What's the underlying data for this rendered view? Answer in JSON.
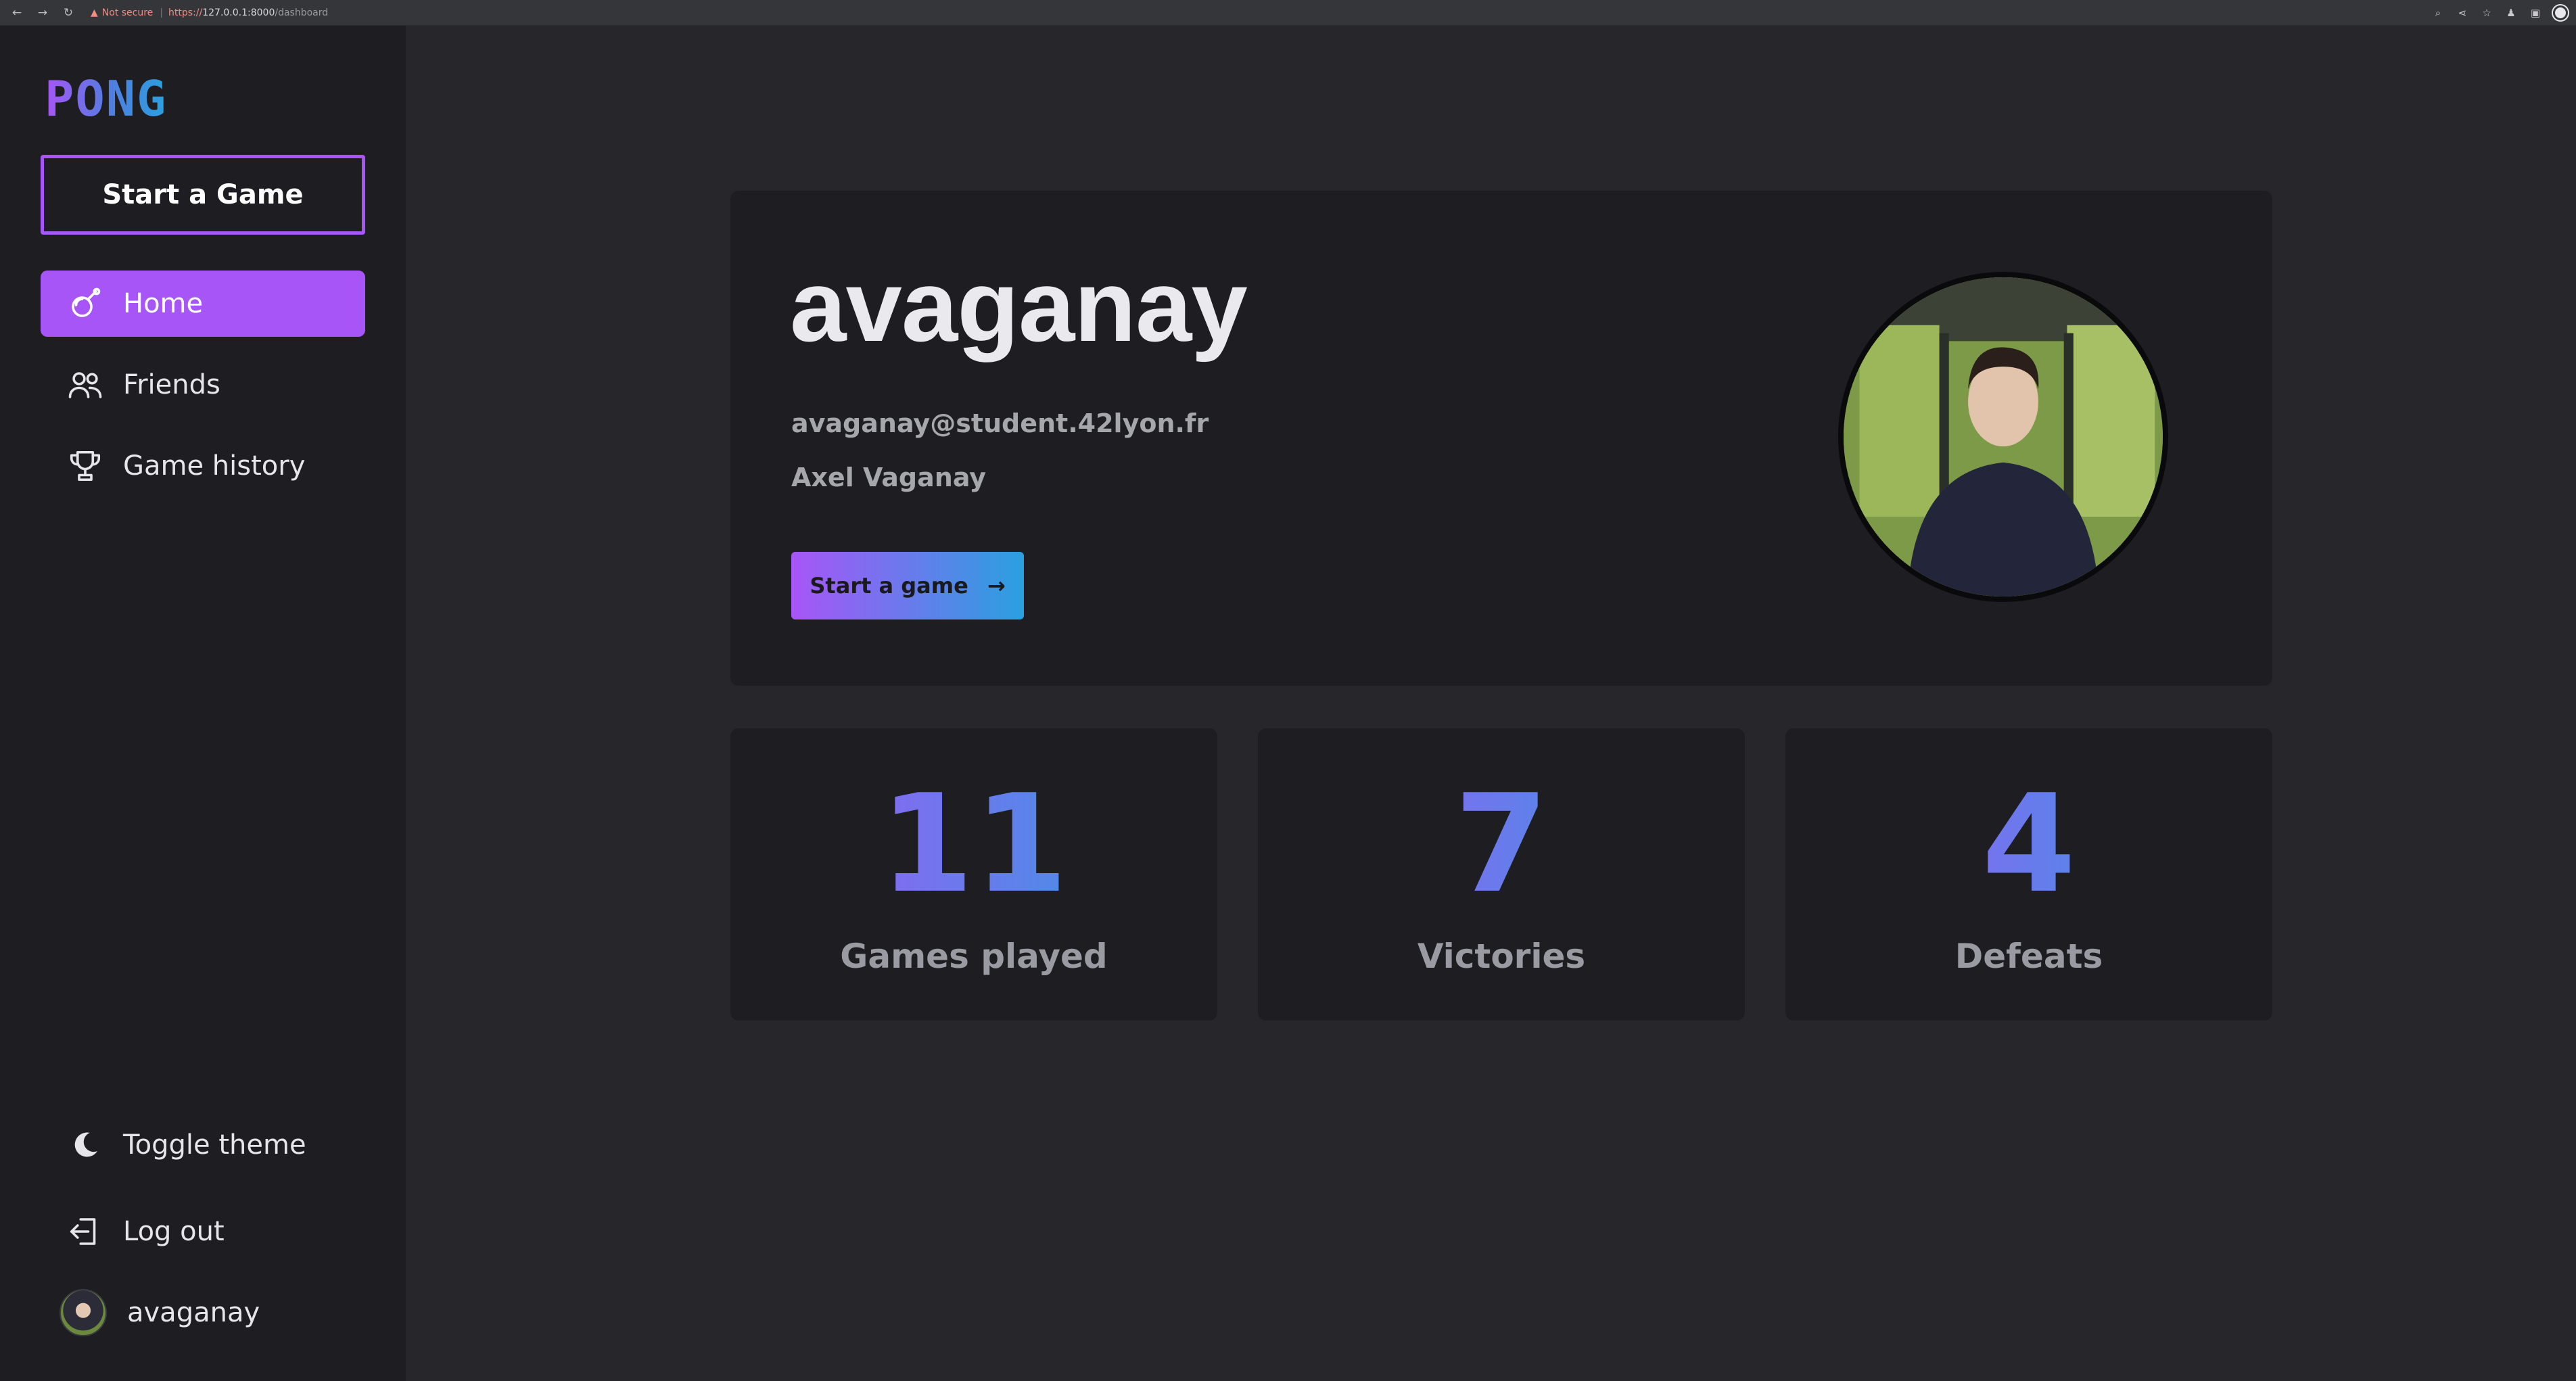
{
  "browser": {
    "not_secure": "Not secure",
    "url_scheme": "https://",
    "url_host": "127.0.0.1:8000",
    "url_path": "/dashboard"
  },
  "sidebar": {
    "logo": "PONG",
    "start_button": "Start a Game",
    "items": [
      {
        "label": "Home",
        "icon": "home-icon",
        "active": true
      },
      {
        "label": "Friends",
        "icon": "friends-icon",
        "active": false
      },
      {
        "label": "Game history",
        "icon": "trophy-icon",
        "active": false
      }
    ],
    "bottom": {
      "toggle_theme": "Toggle theme",
      "logout": "Log out",
      "username": "avaganay"
    }
  },
  "profile": {
    "username": "avaganay",
    "email": "avaganay@student.42lyon.fr",
    "full_name": "Axel Vaganay",
    "start_button": "Start a game"
  },
  "stats": [
    {
      "value": "11",
      "label": "Games played"
    },
    {
      "value": "7",
      "label": "Victories"
    },
    {
      "value": "4",
      "label": "Defeats"
    }
  ],
  "colors": {
    "accent": "#a855f7",
    "accent_blue": "#2aa0e0",
    "background": "#26262b",
    "card": "#1e1e22"
  }
}
